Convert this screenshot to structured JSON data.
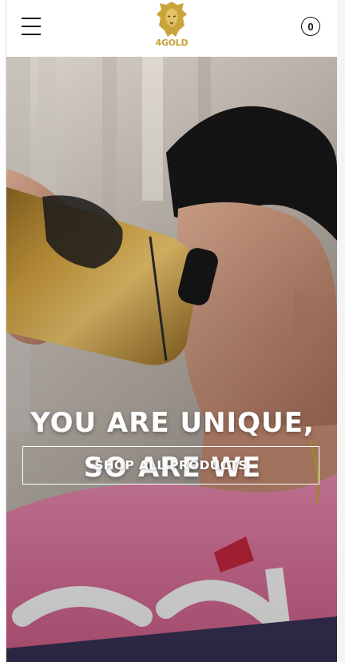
{
  "header": {
    "menu_icon": "hamburger-menu-icon",
    "logo": {
      "text": "4GOLD",
      "icon": "lion-head-icon"
    },
    "cart": {
      "icon": "cart-icon",
      "count": "0"
    }
  },
  "hero": {
    "headline_line1": "YOU ARE UNIQUE,",
    "headline_line2": "SO ARE WE",
    "cta_label": "SHOP ALL PRODUCTS",
    "image_description_icon": "cyclist-drinking-photo"
  },
  "colors": {
    "brand_gold": "#c7a43a",
    "jersey_pink": "#e8759f",
    "header_bg": "#ffffff"
  }
}
